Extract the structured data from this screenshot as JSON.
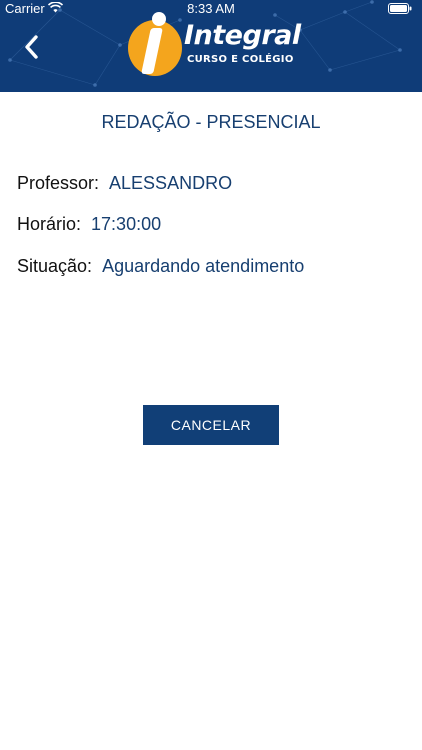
{
  "status_bar": {
    "carrier": "Carrier",
    "time": "8:33 AM",
    "wifi_icon": "wifi-icon",
    "battery_icon": "battery-icon"
  },
  "header": {
    "back_icon": "chevron-left-icon",
    "logo": {
      "name": "Integral",
      "subtitle": "CURSO E COLÉGIO"
    },
    "background_color": "#0f3c78",
    "logo_color": "#f4a51d"
  },
  "page": {
    "title": "REDAÇÃO - PRESENCIAL"
  },
  "details": {
    "professor_label": "Professor:",
    "professor_value": "ALESSANDRO",
    "horario_label": "Horário:",
    "horario_value": "17:30:00",
    "situacao_label": "Situação:",
    "situacao_value": "Aguardando atendimento"
  },
  "actions": {
    "cancel_label": "CANCELAR"
  },
  "colors": {
    "accent": "#113f77",
    "value_text": "#173f70"
  }
}
